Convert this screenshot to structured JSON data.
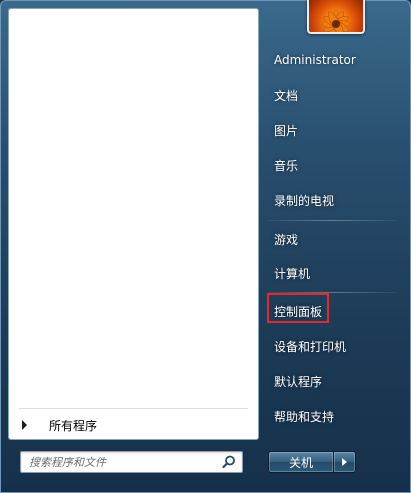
{
  "left_pane": {
    "all_programs_label": "所有程序",
    "search": {
      "placeholder": "搜索程序和文件"
    }
  },
  "right_pane": {
    "username": "Administrator",
    "items": [
      {
        "label": "文档"
      },
      {
        "label": "图片"
      },
      {
        "label": "音乐"
      },
      {
        "label": "录制的电视"
      },
      {
        "label": "游戏"
      },
      {
        "label": "计算机"
      },
      {
        "label": "控制面板",
        "highlighted": true
      },
      {
        "label": "设备和打印机"
      },
      {
        "label": "默认程序"
      },
      {
        "label": "帮助和支持"
      }
    ]
  },
  "shutdown": {
    "label": "关机"
  },
  "colors": {
    "highlight_border": "#e8272c",
    "menu_bg": "#294f6f"
  },
  "icons": {
    "search": "search-icon",
    "avatar": "user-avatar-flower",
    "arrow": "chevron-right-icon"
  }
}
